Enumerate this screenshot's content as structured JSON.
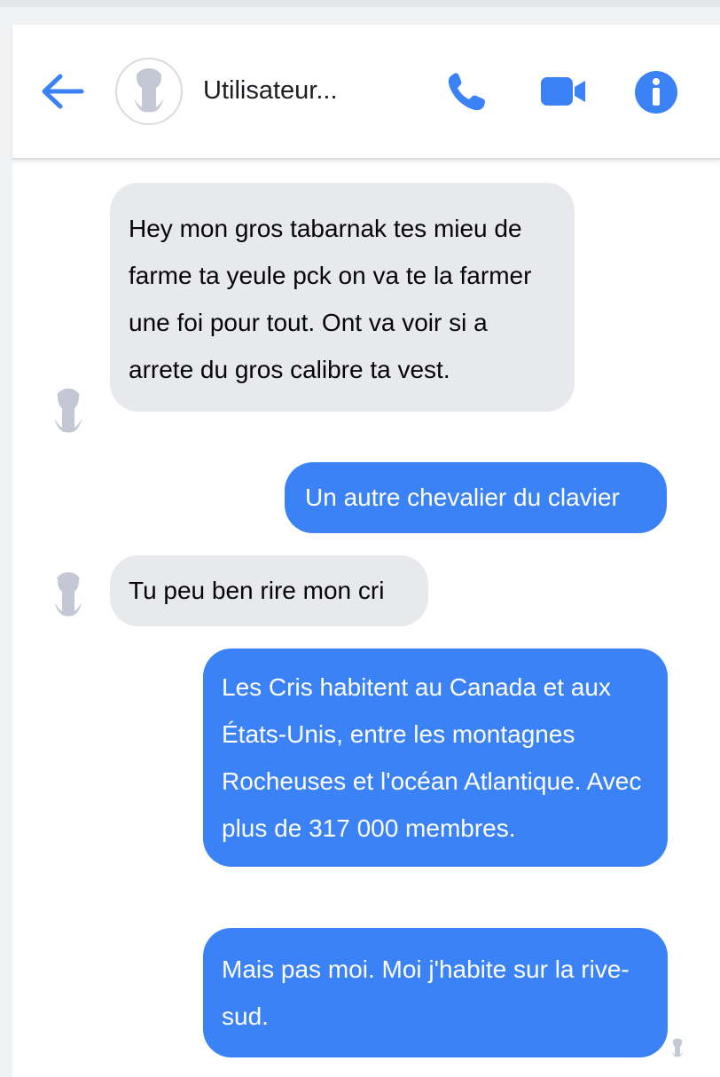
{
  "header": {
    "contact_name": "Utilisateur...",
    "icons": [
      "back-arrow-icon",
      "avatar-placeholder",
      "phone-icon",
      "video-camera-icon",
      "info-icon"
    ],
    "accent_color": "#3b82f6"
  },
  "messages": [
    {
      "direction": "incoming",
      "text": "Hey mon gros tabarnak tes mieu de farme ta yeule pck on va te la farmer une foi pour tout. Ont va voir si a arrete du gros calibre ta vest."
    },
    {
      "direction": "outgoing",
      "text": "Un autre chevalier du clavier"
    },
    {
      "direction": "incoming",
      "text": "Tu peu ben rire mon cri"
    },
    {
      "direction": "outgoing",
      "text": "Les Cris habitent au Canada et aux États-Unis, entre les montagnes Rocheuses et l'océan Atlantique. Avec plus de 317 000 membres."
    },
    {
      "direction": "outgoing",
      "text": "Mais pas moi. Moi j'habite sur la rive-sud."
    }
  ],
  "colors": {
    "incoming_bubble": "#e8e9ed",
    "outgoing_bubble": "#3b82f6",
    "background": "#f1f2f3"
  }
}
